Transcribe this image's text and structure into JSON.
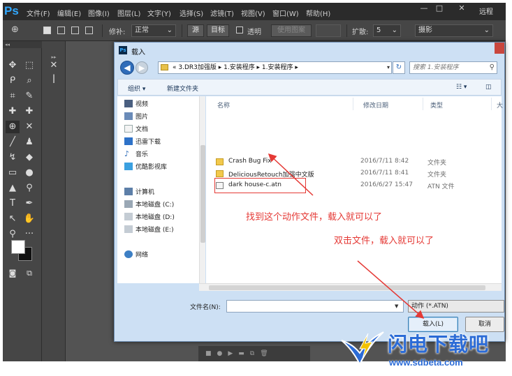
{
  "app": {
    "logo": "Ps",
    "menu": [
      "文件(F)",
      "编辑(E)",
      "图像(I)",
      "图层(L)",
      "文字(Y)",
      "选择(S)",
      "滤镜(T)",
      "视图(V)",
      "窗口(W)",
      "帮助(H)"
    ],
    "window_controls": [
      "—",
      "□",
      "✕"
    ],
    "remote_label": "远程",
    "options_bar": {
      "feather_label": "修补:",
      "mode_value": "正常",
      "source_button": "源",
      "target_button": "目标",
      "transparent_label": "透明",
      "use_pattern_button": "使用图案",
      "diffusion_label": "扩散:",
      "diffusion_value": "5",
      "workspace_value": "摄影"
    }
  },
  "dialog": {
    "icon": "Ps",
    "title": "载入",
    "address": {
      "path": "« 3.DR3加强版 ▸ 1.安装程序 ▸ 1.安装程序 ▸"
    },
    "search": {
      "placeholder": "搜索 1.安装程序"
    },
    "commands": {
      "organize": "组织 ▾",
      "new_folder": "新建文件夹"
    },
    "nav_items": [
      {
        "label": "视频",
        "icon": "video-icon"
      },
      {
        "label": "图片",
        "icon": "picture-icon"
      },
      {
        "label": "文档",
        "icon": "document-icon"
      },
      {
        "label": "迅雷下载",
        "icon": "download-icon"
      },
      {
        "label": "音乐",
        "icon": "music-icon"
      },
      {
        "label": "优酷影视库",
        "icon": "youku-icon"
      },
      {
        "label": "计算机",
        "icon": "computer-icon"
      },
      {
        "label": "本地磁盘 (C:)",
        "icon": "disk-icon"
      },
      {
        "label": "本地磁盘 (D:)",
        "icon": "disk-icon"
      },
      {
        "label": "本地磁盘 (E:)",
        "icon": "disk-icon"
      },
      {
        "label": "网络",
        "icon": "network-icon"
      }
    ],
    "columns": [
      "名称",
      "修改日期",
      "类型",
      "大"
    ],
    "files": [
      {
        "name": "Crash Bug Fix",
        "date": "2016/7/11 8:42",
        "type": "文件夹",
        "icon": "folder-icon"
      },
      {
        "name": "DeliciousRetouch加强中文版",
        "date": "2016/7/11 8:41",
        "type": "文件夹",
        "icon": "folder-icon"
      },
      {
        "name": "dark house-c.atn",
        "date": "2016/6/27 15:47",
        "type": "ATN 文件",
        "icon": "atn-file-icon"
      }
    ],
    "filename_label": "文件名(N):",
    "filename_value": "",
    "filetype_value": "动作 (*.ATN)",
    "load_button": "载入(L)",
    "cancel_button": "取消"
  },
  "annotations": {
    "note_1": "找到这个动作文件，载入就可以了",
    "note_2": "双击文件，载入就可以了",
    "color": "#e53935"
  },
  "watermark": {
    "brand": "闪电下载吧",
    "url": "www.sdbeta.com",
    "color": "#2b6bd6"
  }
}
